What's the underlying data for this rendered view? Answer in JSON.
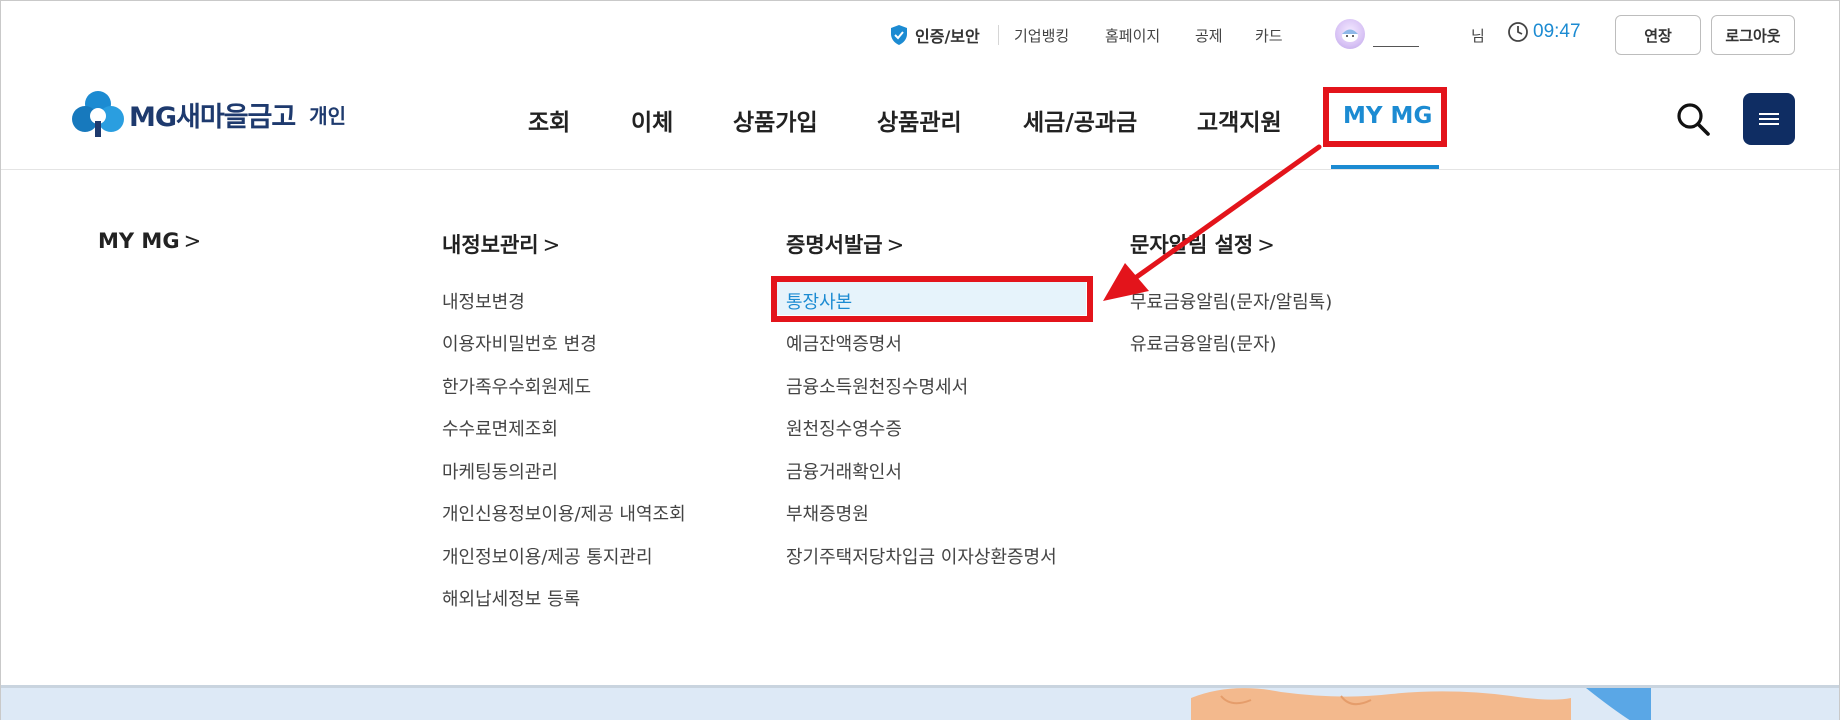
{
  "topbar": {
    "cert_label": "인증/보안",
    "links": [
      "기업뱅킹",
      "홈페이지",
      "공제",
      "카드"
    ],
    "user_suffix": "님",
    "session_time": "09:47",
    "extend_label": "연장",
    "logout_label": "로그아웃"
  },
  "logo": {
    "brand": "MG새마을금고",
    "sub": "개인"
  },
  "gnb": {
    "items": [
      "조회",
      "이체",
      "상품가입",
      "상품관리",
      "세금/공과금",
      "고객지원",
      "MY MG"
    ],
    "active_index": 6
  },
  "mega_menu": {
    "columns": [
      {
        "title": "MY MG",
        "items": []
      },
      {
        "title": "내정보관리",
        "items": [
          "내정보변경",
          "이용자비밀번호 변경",
          "한가족우수회원제도",
          "수수료면제조회",
          "마케팅동의관리",
          "개인신용정보이용/제공 내역조회",
          "개인정보이용/제공 통지관리",
          "해외납세정보 등록"
        ]
      },
      {
        "title": "증명서발급",
        "items": [
          "통장사본",
          "예금잔액증명서",
          "금융소득원천징수명세서",
          "원천징수영수증",
          "금융거래확인서",
          "부채증명원",
          "장기주택저당차입금 이자상환증명서"
        ]
      },
      {
        "title": "문자알림 설정",
        "items": [
          "무료금융알림(문자/알림톡)",
          "유료금융알림(문자)"
        ]
      }
    ],
    "chevron": ">",
    "selected": "통장사본"
  },
  "colors": {
    "accent": "#1c8bd2",
    "brand_navy": "#0f2d63",
    "annotation_red": "#e3141b",
    "selected_bg": "#e6f3fb"
  },
  "icons": {
    "cert": "shield-check-icon",
    "timer": "clock-icon",
    "search": "search-icon",
    "menu": "hamburger-menu-icon"
  }
}
